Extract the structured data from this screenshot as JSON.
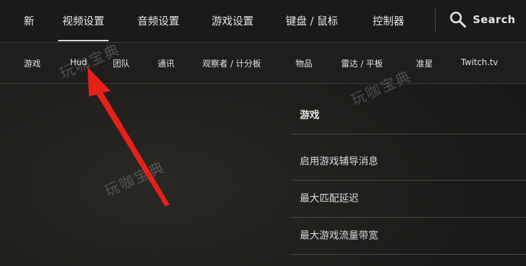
{
  "top_tabs": [
    {
      "label": "新"
    },
    {
      "label": "视频设置",
      "active": true
    },
    {
      "label": "音频设置"
    },
    {
      "label": "游戏设置"
    },
    {
      "label": "键盘 / 鼠标"
    },
    {
      "label": "控制器"
    }
  ],
  "search": {
    "label": "Search",
    "icon": "search-icon"
  },
  "sub_tabs": [
    {
      "label": "游戏"
    },
    {
      "label": "Hud"
    },
    {
      "label": "团队"
    },
    {
      "label": "通讯"
    },
    {
      "label": "观察者 / 计分板"
    },
    {
      "label": "物品"
    },
    {
      "label": "雷达 / 平板"
    },
    {
      "label": "准星"
    },
    {
      "label": "Twitch.tv"
    }
  ],
  "section": {
    "title": "游戏",
    "rows": [
      {
        "label": "启用游戏辅导消息"
      },
      {
        "label": "最大匹配延迟"
      },
      {
        "label": "最大游戏流量带宽"
      }
    ]
  },
  "watermark": "玩咖宝典",
  "annotation": {
    "color": "#e8201a",
    "icon": "red-arrow-annotation"
  }
}
